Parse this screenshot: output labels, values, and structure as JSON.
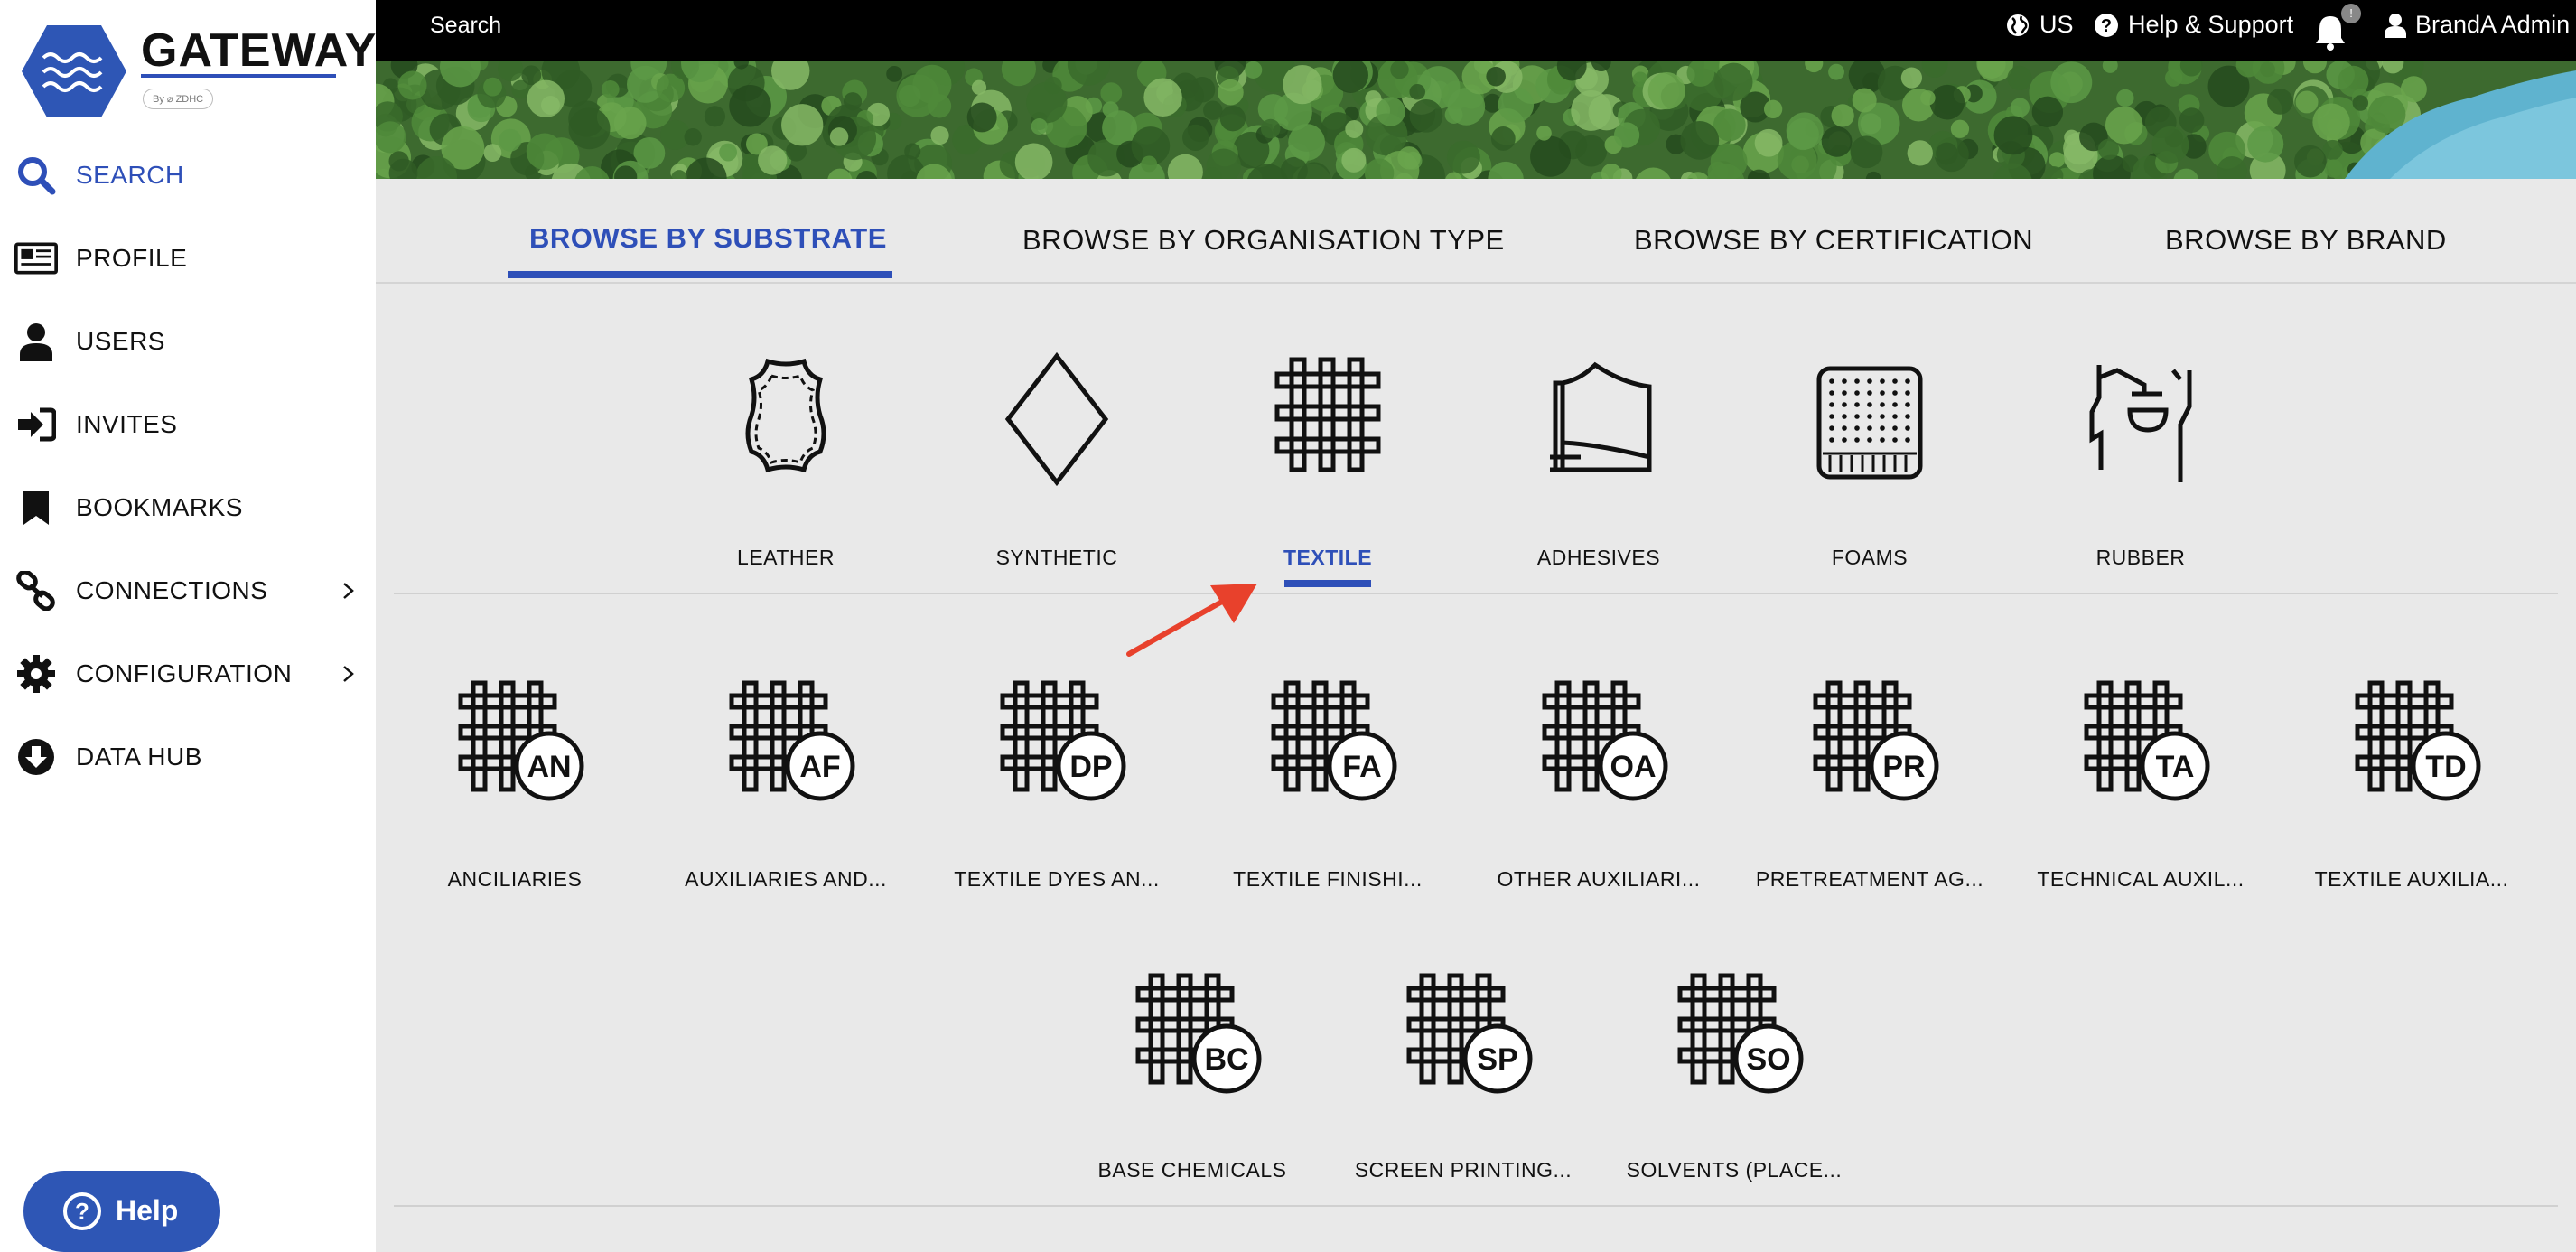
{
  "brand": {
    "title": "GATEWAY",
    "sub": "By ⌀ ZDHC"
  },
  "sidebar": {
    "items": [
      {
        "label": "SEARCH",
        "icon": "search-icon",
        "active": true
      },
      {
        "label": "PROFILE",
        "icon": "profile-icon"
      },
      {
        "label": "USERS",
        "icon": "user-icon"
      },
      {
        "label": "INVITES",
        "icon": "sign-in-icon"
      },
      {
        "label": "BOOKMARKS",
        "icon": "bookmark-icon"
      },
      {
        "label": "CONNECTIONS",
        "icon": "link-icon",
        "expandable": true
      },
      {
        "label": "CONFIGURATION",
        "icon": "gear-icon",
        "expandable": true
      },
      {
        "label": "DATA HUB",
        "icon": "download-circle-icon"
      }
    ],
    "help_label": "Help"
  },
  "topbar": {
    "search_label": "Search",
    "region": "US",
    "help_support": "Help & Support",
    "notifications_count": "!",
    "user": "BrandA Admin"
  },
  "tabs": [
    "BROWSE BY SUBSTRATE",
    "BROWSE BY ORGANISATION TYPE",
    "BROWSE BY CERTIFICATION",
    "BROWSE BY BRAND"
  ],
  "active_tab": "BROWSE BY SUBSTRATE",
  "substrates": [
    {
      "label": "LEATHER",
      "icon": "leather-icon"
    },
    {
      "label": "SYNTHETIC",
      "icon": "diamond-icon"
    },
    {
      "label": "TEXTILE",
      "icon": "textile-weave-icon"
    },
    {
      "label": "ADHESIVES",
      "icon": "adhesive-icon"
    },
    {
      "label": "FOAMS",
      "icon": "foam-icon"
    },
    {
      "label": "RUBBER",
      "icon": "rubber-tap-icon"
    }
  ],
  "active_substrate": "TEXTILE",
  "groups": [
    {
      "code": "AN",
      "label": "ANCILIARIES"
    },
    {
      "code": "AF",
      "label": "AUXILIARIES AND..."
    },
    {
      "code": "DP",
      "label": "TEXTILE DYES AN..."
    },
    {
      "code": "FA",
      "label": "TEXTILE FINISHI..."
    },
    {
      "code": "OA",
      "label": "OTHER AUXILIARI..."
    },
    {
      "code": "PR",
      "label": "PRETREATMENT AG..."
    },
    {
      "code": "TA",
      "label": "TECHNICAL AUXIL..."
    },
    {
      "code": "TD",
      "label": "TEXTILE AUXILIA..."
    },
    {
      "code": "BC",
      "label": "BASE CHEMICALS"
    },
    {
      "code": "SP",
      "label": "SCREEN PRINTING..."
    },
    {
      "code": "SO",
      "label": "SOLVENTS (PLACE..."
    }
  ],
  "colors": {
    "accent": "#2e4fb8",
    "arrow": "#e8412c",
    "topbar": "#000000"
  }
}
